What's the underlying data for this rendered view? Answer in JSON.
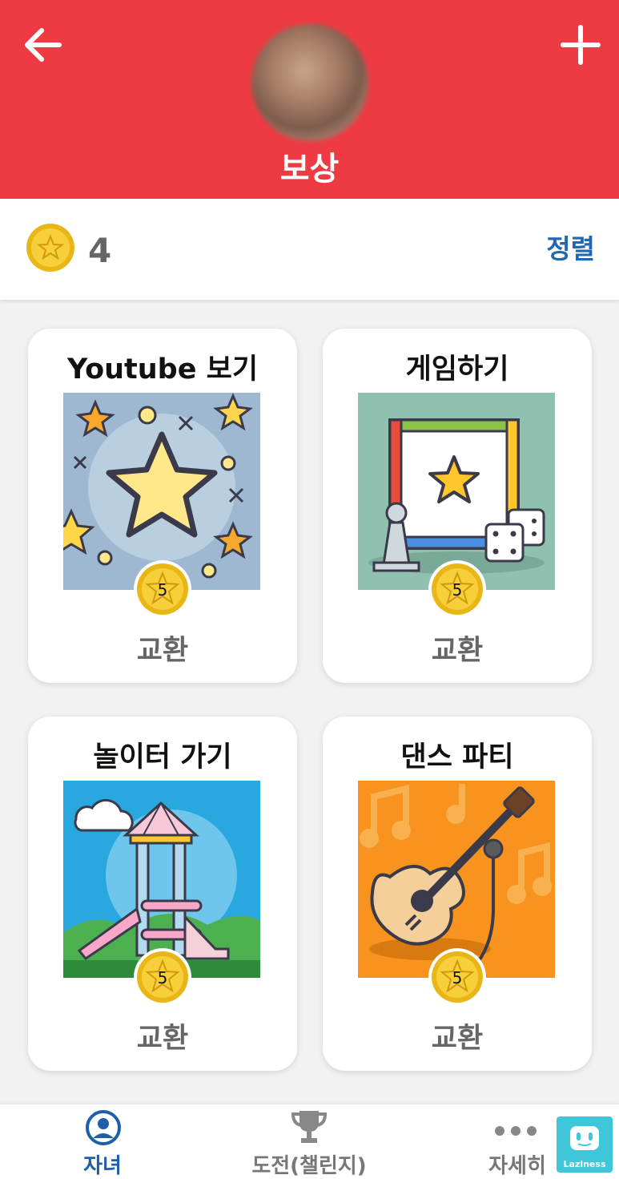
{
  "header": {
    "title": "보상"
  },
  "balance": {
    "value": "4",
    "sort_label": "정렬"
  },
  "rewards": [
    {
      "name": "Youtube 보기",
      "price": "5",
      "action": "교환",
      "image": "star-sparkle"
    },
    {
      "name": "게임하기",
      "price": "5",
      "action": "교환",
      "image": "board-game"
    },
    {
      "name": "놀이터 가기",
      "price": "5",
      "action": "교환",
      "image": "playground"
    },
    {
      "name": "댄스 파티",
      "price": "5",
      "action": "교환",
      "image": "guitar-music"
    }
  ],
  "tabs": [
    {
      "label": "자녀",
      "icon": "person-icon",
      "active": true
    },
    {
      "label": "도전(챌린지)",
      "icon": "trophy-icon",
      "active": false
    },
    {
      "label": "자세히",
      "icon": "more-dots-icon",
      "active": false
    }
  ],
  "badge": {
    "text": "Laziness"
  },
  "colors": {
    "header": "#ee3b43",
    "accent": "#2167b1",
    "coin": "#f2c21b"
  }
}
